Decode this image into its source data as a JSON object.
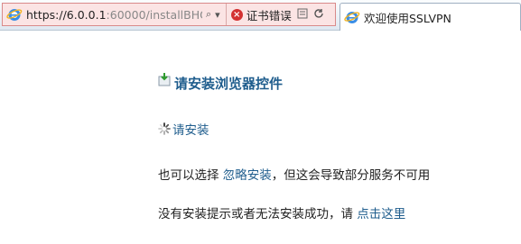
{
  "browser": {
    "address": {
      "url_main": "https://6.0.0.1",
      "url_rest": ":60000/installBHO.h",
      "search_glyph": "⌕",
      "dropdown_glyph": "▾",
      "cert_error_label": "证书错误"
    },
    "tab": {
      "title": "欢迎使用SSLVPN"
    }
  },
  "page": {
    "heading": "请安装浏览器控件",
    "install_link": "请安装",
    "ignore": {
      "prefix": "也可以选择 ",
      "link": "忽略安装",
      "suffix": "，但这会导致部分服务不可用"
    },
    "fallback": {
      "prefix": "没有安装提示或者无法安装成功，请 ",
      "link": "点击这里"
    }
  },
  "colors": {
    "link": "#1f5d8d",
    "cert_error_bg": "#fbe4e4",
    "cert_error_icon": "#d33131"
  },
  "icons": [
    "ie-icon",
    "search-icon",
    "dropdown-icon",
    "cert-error-icon",
    "compat-icon",
    "refresh-icon",
    "download-icon",
    "loading-spinner-icon"
  ]
}
